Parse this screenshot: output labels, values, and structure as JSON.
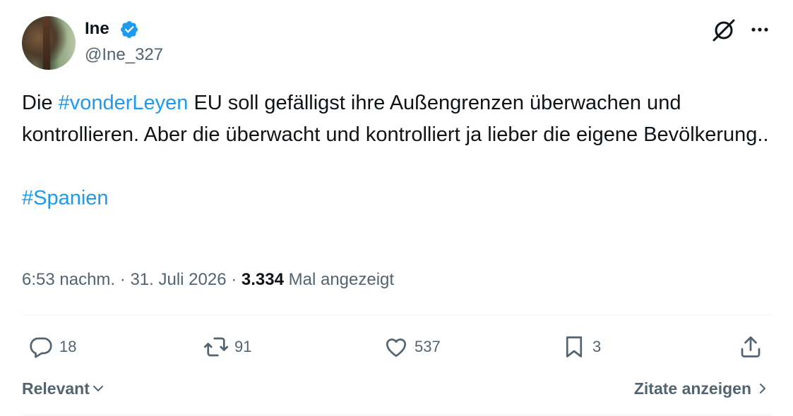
{
  "author": {
    "display_name": "Ine",
    "handle": "@Ine_327",
    "verified": true
  },
  "tweet": {
    "text_before": "Die ",
    "hashtag1": "#vonderLeyen",
    "text_after": " EU soll gefälligst ihre Außengrenzen überwachen und kontrollieren. Aber die überwacht und kontrolliert ja lieber die eigene Bevölkerung..",
    "hashtag2": "#Spanien"
  },
  "meta": {
    "time": "6:53 nachm.",
    "separator": "·",
    "date": "31. Juli 2026",
    "views_count": "3.334",
    "views_label": "Mal angezeigt"
  },
  "actions": {
    "replies": "18",
    "reposts": "91",
    "likes": "537",
    "bookmarks": "3"
  },
  "footer": {
    "sort_label": "Relevant",
    "quotes_label": "Zitate anzeigen"
  },
  "icons": {
    "verified": "verified-badge-icon",
    "grok": "grok-icon",
    "more": "more-icon",
    "reply": "reply-icon",
    "repost": "repost-icon",
    "like": "heart-icon",
    "bookmark": "bookmark-icon",
    "share": "share-icon"
  },
  "colors": {
    "accent": "#1d9bf0",
    "text": "#0f1419",
    "muted": "#536471",
    "divider": "#eff3f4"
  }
}
